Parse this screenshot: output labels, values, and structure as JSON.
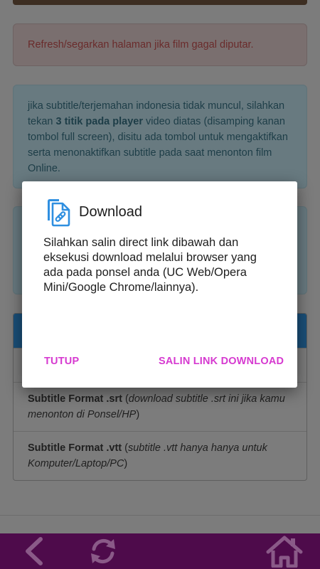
{
  "page": {
    "alert_refresh": "Refresh/segarkan halaman jika film gagal diputar.",
    "info_subtitle": {
      "part1": "jika subtitle/terjemahan indonesia tidak muncul, silahkan tekan ",
      "bold": "3 titik pada player",
      "part2": " video diatas (disamping kanan tombol full screen), disitu ada tombol untuk mengaktifkan serta menonaktifkan subtitle pada saat menonton film Online."
    },
    "subtitle_rows": [
      {
        "title": "Subtitle Format .srt",
        "open": " (",
        "note": "download subtitle .srt ini jika kamu menonton di Ponsel/HP",
        "close": ")"
      },
      {
        "title": "Subtitle Format .vtt",
        "open": " (",
        "note": "subtitle .vtt hanya hanya untuk Komputer/Laptop/PC",
        "close": ")"
      }
    ]
  },
  "dialog": {
    "title": "Download",
    "message": "Silahkan salin direct link dibawah dan eksekusi download melalui browser yang ada pada ponsel anda (UC Web/Opera Mini/Google Chrome/lainnya).",
    "close_label": "TUTUP",
    "copy_label": "SALIN LINK DOWNLOAD",
    "icon": "copy-link-icon"
  },
  "bottom_nav": {
    "icons": [
      "back-icon",
      "refresh-icon",
      "home-icon"
    ]
  },
  "colors": {
    "accent": "#d63ad0",
    "nav_bar": "#4e0b4b",
    "icon_blue": "#2f8fe0"
  }
}
